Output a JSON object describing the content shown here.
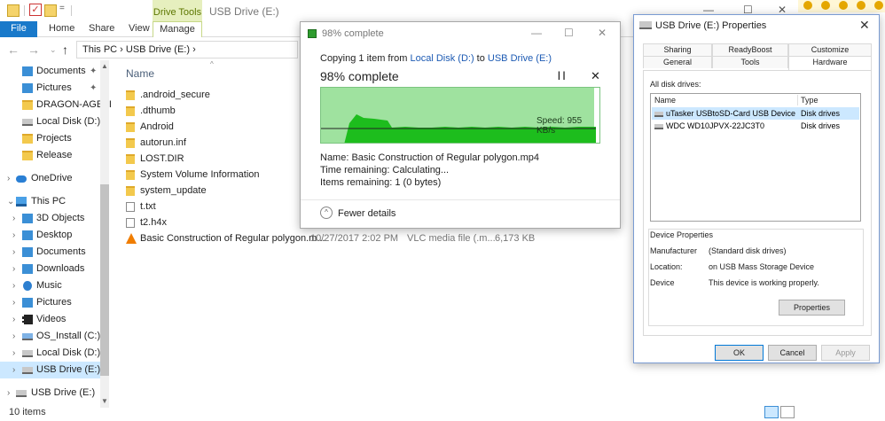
{
  "explorer": {
    "title": "USB Drive (E:)",
    "ribbon": {
      "file": "File",
      "home": "Home",
      "share": "Share",
      "view": "View",
      "contextual_group": "Drive Tools",
      "manage": "Manage"
    },
    "address": "This PC  ›  USB Drive (E:)  ›",
    "nav": [
      {
        "label": "Documents",
        "pinned": true
      },
      {
        "label": "Pictures",
        "pinned": true
      },
      {
        "label": "DRAGON-AGE-II"
      },
      {
        "label": "Local Disk (D:)"
      },
      {
        "label": "Projects"
      },
      {
        "label": "Release"
      },
      {
        "label": "OneDrive"
      },
      {
        "label": "This PC"
      },
      {
        "label": "3D Objects"
      },
      {
        "label": "Desktop"
      },
      {
        "label": "Documents"
      },
      {
        "label": "Downloads"
      },
      {
        "label": "Music"
      },
      {
        "label": "Pictures"
      },
      {
        "label": "Videos"
      },
      {
        "label": "OS_Install (C:)"
      },
      {
        "label": "Local Disk (D:)"
      },
      {
        "label": "USB Drive (E:)",
        "selected": true
      },
      {
        "label": "USB Drive (E:)"
      }
    ],
    "columns": {
      "name": "Name"
    },
    "files": [
      {
        "name": ".android_secure",
        "icon": "folder-icon"
      },
      {
        "name": ".dthumb",
        "icon": "folder-icon"
      },
      {
        "name": "Android",
        "icon": "folder-icon"
      },
      {
        "name": "autorun.inf",
        "icon": "folder-icon"
      },
      {
        "name": "LOST.DIR",
        "icon": "folder-icon"
      },
      {
        "name": "System Volume Information",
        "icon": "folder-icon"
      },
      {
        "name": "system_update",
        "icon": "folder-icon"
      },
      {
        "name": "t.txt",
        "icon": "text-file-icon"
      },
      {
        "name": "t2.h4x",
        "icon": "file-icon"
      },
      {
        "name": "Basic Construction of Regular polygon.m...",
        "icon": "vlc-icon",
        "date": "10/27/2017 2:02 PM",
        "type": "VLC media file (.m...",
        "size": "6,173 KB"
      }
    ],
    "status": "10 items"
  },
  "copy_dialog": {
    "title": "98% complete",
    "copying_prefix": "Copying 1 item from ",
    "source": "Local Disk (D:)",
    "to_word": " to ",
    "destination": "USB Drive (E:)",
    "percent_text": "98% complete",
    "progress": 0.98,
    "speed": "Speed: 955 KB/s",
    "name_line": "Name: Basic Construction of Regular polygon.mp4",
    "time_line": "Time remaining: Calculating...",
    "items_line": "Items remaining: 1 (0 bytes)",
    "fewer_details": "Fewer details"
  },
  "properties_dialog": {
    "title": "USB Drive (E:) Properties",
    "tabs_row1": [
      "Sharing",
      "ReadyBoost",
      "Customize"
    ],
    "tabs_row2": [
      "General",
      "Tools",
      "Hardware"
    ],
    "active_tab": "Hardware",
    "all_disk_drives": "All disk drives:",
    "list_headers": {
      "name": "Name",
      "type": "Type"
    },
    "drives": [
      {
        "name": "uTasker USBtoSD-Card USB Device",
        "type": "Disk drives",
        "selected": true
      },
      {
        "name": "WDC WD10JPVX-22JC3T0",
        "type": "Disk drives"
      }
    ],
    "device_properties": "Device Properties",
    "manufacturer_label": "Manufacturer",
    "manufacturer_value": "(Standard disk drives)",
    "location_label": "Location:",
    "location_value": "on USB Mass Storage Device",
    "status_label": "Device",
    "status_value": "This device is working properly.",
    "properties_btn": "Properties",
    "ok": "OK",
    "cancel": "Cancel",
    "apply": "Apply"
  },
  "colors": {
    "accent": "#1979ca",
    "selection": "#cce8ff",
    "graph_fill": "#9fe29f",
    "graph_speed": "#1dbd1d"
  }
}
